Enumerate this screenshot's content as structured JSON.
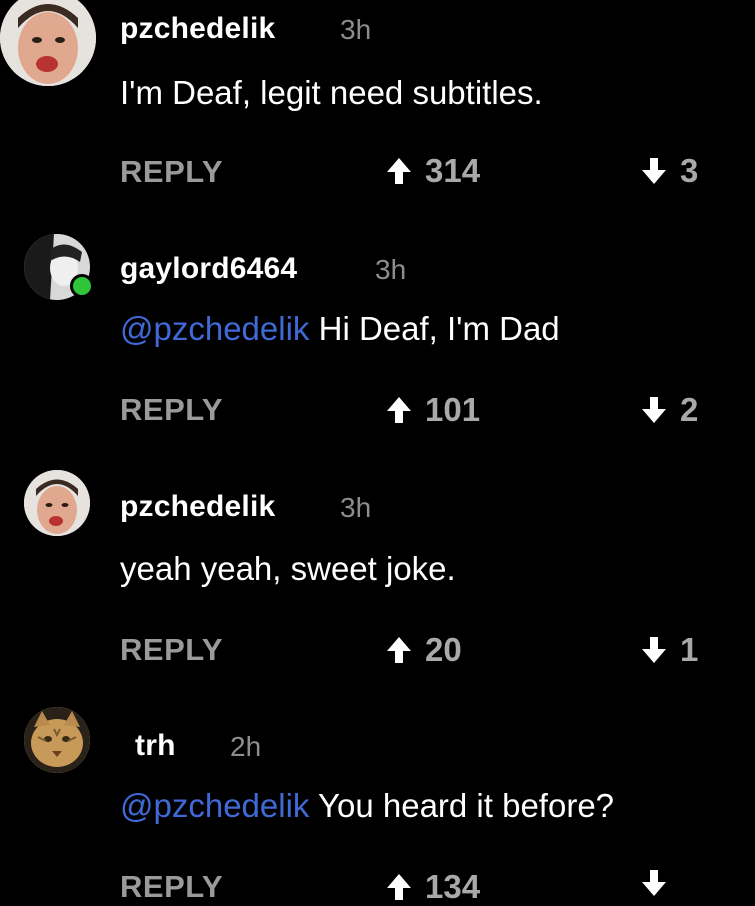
{
  "comments": [
    {
      "username": "pzchedelik",
      "time": "3h",
      "mention": "",
      "text": "I'm Deaf, legit need subtitles.",
      "reply_label": "REPLY",
      "upvotes": "314",
      "downvotes": "3"
    },
    {
      "username": "gaylord6464",
      "time": "3h",
      "mention": "@pzchedelik",
      "text": " Hi Deaf, I'm Dad",
      "reply_label": "REPLY",
      "upvotes": "101",
      "downvotes": "2"
    },
    {
      "username": "pzchedelik",
      "time": "3h",
      "mention": "",
      "text": "yeah yeah, sweet joke.",
      "reply_label": "REPLY",
      "upvotes": "20",
      "downvotes": "1"
    },
    {
      "username": "trh",
      "time": "2h",
      "mention": "@pzchedelik",
      "text": " You heard it before?",
      "reply_label": "REPLY",
      "upvotes": "134",
      "downvotes": ""
    }
  ],
  "colors": {
    "background": "#000000",
    "mention": "#4169d6",
    "meta": "#8d8d8d",
    "online": "#2fc53a"
  },
  "icons": {
    "upvote": "arrow-up-icon",
    "downvote": "arrow-down-icon"
  }
}
